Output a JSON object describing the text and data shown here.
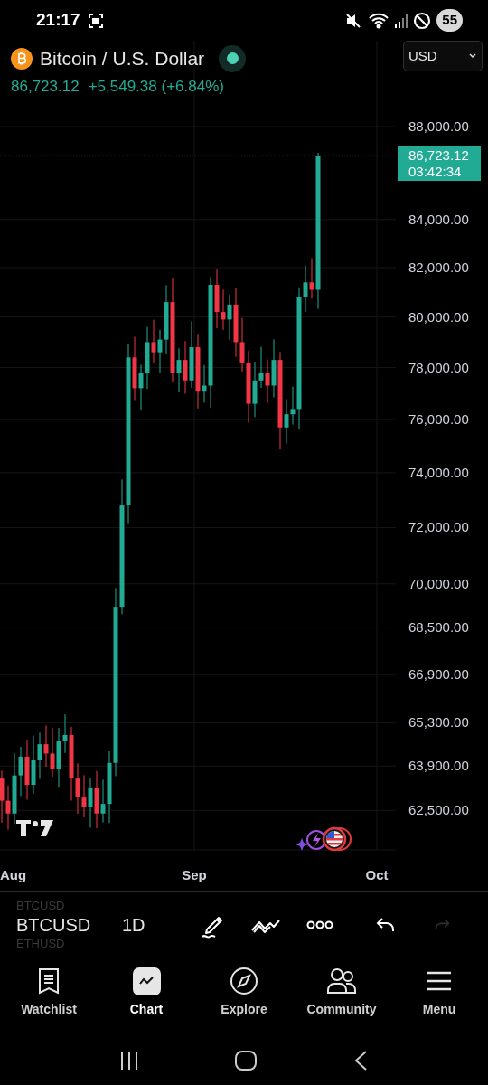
{
  "status_bar": {
    "time": "21:17",
    "battery": "55"
  },
  "header": {
    "symbol_name": "Bitcoin / U.S. Dollar",
    "market_open": true,
    "price": "86,723.12",
    "change": "+5,549.38 (+6.84%)",
    "currency": "USD"
  },
  "chart": {
    "price_axis": [
      "88,000.00",
      "84,000.00",
      "82,000.00",
      "80,000.00",
      "78,000.00",
      "76,000.00",
      "74,000.00",
      "72,000.00",
      "70,000.00",
      "68,500.00",
      "66,900.00",
      "65,300.00",
      "63,900.00",
      "62,500.00"
    ],
    "time_axis": [
      "Aug",
      "Sep",
      "Oct"
    ],
    "last_price": {
      "price": "86,723.12",
      "countdown": "03:42:34"
    }
  },
  "toolbar": {
    "symbols": [
      {
        "label": "BTCUSD",
        "selected": false
      },
      {
        "label": "BTCUSD",
        "selected": true
      },
      {
        "label": "ETHUSD",
        "selected": false
      }
    ],
    "interval": "1D",
    "undo_disabled": false,
    "redo_disabled": true
  },
  "nav": [
    {
      "label": "Watchlist",
      "selected": false
    },
    {
      "label": "Chart",
      "selected": true
    },
    {
      "label": "Explore",
      "selected": false
    },
    {
      "label": "Community",
      "selected": false
    },
    {
      "label": "Menu",
      "selected": false
    }
  ]
}
